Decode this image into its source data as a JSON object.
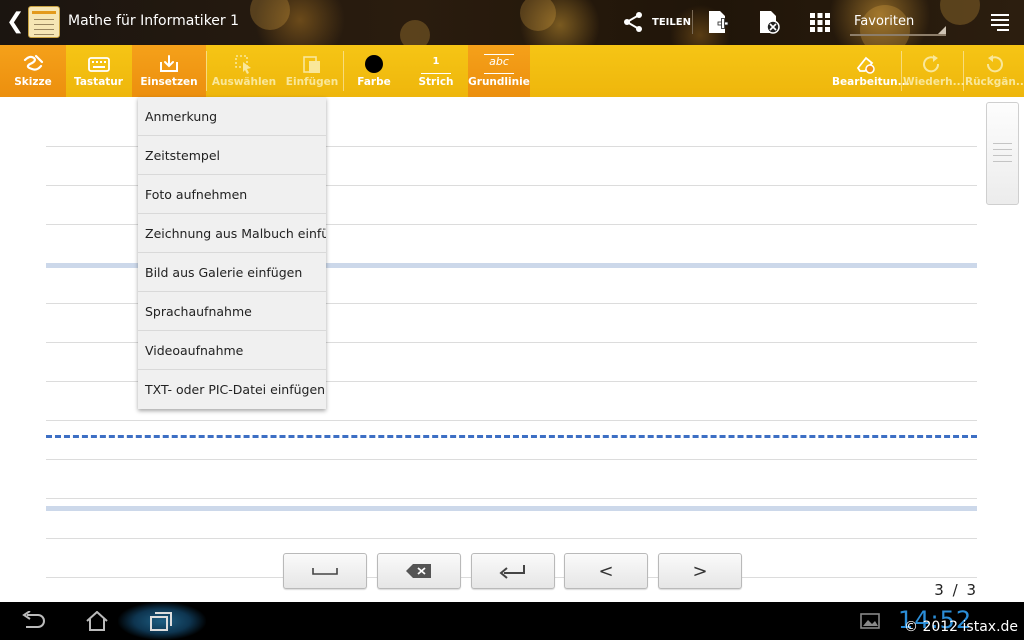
{
  "titlebar": {
    "title": "Mathe für Informatiker 1",
    "share_label": "TEILEN",
    "favorites_label": "Favoriten"
  },
  "toolbar": {
    "sketch": "Skizze",
    "keyboard": "Tastatur",
    "insert": "Einsetzen",
    "select": "Auswählen",
    "paste": "Einfügen",
    "color": "Farbe",
    "stroke": "Strich",
    "stroke_value": "1",
    "baseline": "Grundlinie",
    "baseline_sample": "abc",
    "edit": "Bearbeitun...",
    "redo": "Wiederh...",
    "undo": "Rückgän..."
  },
  "insert_menu": {
    "items": [
      "Anmerkung",
      "Zeitstempel",
      "Foto aufnehmen",
      "Zeichnung aus Malbuch einfügen",
      "Bild aus Galerie einfügen",
      "Sprachaufnahme",
      "Videoaufnahme",
      "TXT- oder PIC-Datei einfügen"
    ]
  },
  "keys": {
    "prev_label": "<",
    "next_label": ">"
  },
  "page": {
    "current": "3",
    "separator": "/",
    "total": "3"
  },
  "statusbar": {
    "clock": "14:52",
    "watermark": "© 2012 istax.de"
  },
  "colors": {
    "toolbar": "#f2bd10",
    "toolbar_active": "#f09615",
    "rule_blue": "#ccd8ea",
    "rule_dashed": "#3d6fc4",
    "clock": "#2b8ed8"
  }
}
